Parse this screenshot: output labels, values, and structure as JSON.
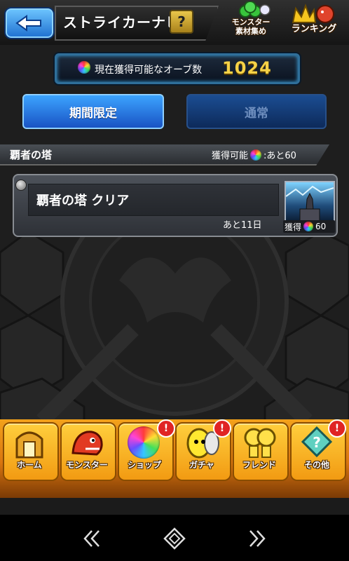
{
  "header": {
    "title": "ストライカーナビ",
    "help_label": "?",
    "collect_label_1": "モンスター",
    "collect_label_2": "素材集め",
    "ranking_label": "ランキング"
  },
  "orb_counter": {
    "label": "現在獲得可能なオーブ数",
    "value": "1024"
  },
  "tabs": [
    {
      "label": "期間限定",
      "active": true
    },
    {
      "label": "通常",
      "active": false
    }
  ],
  "section": {
    "title": "覇者の塔",
    "status_prefix": "獲得可能",
    "status_suffix": ":あと60"
  },
  "quest": {
    "name": "覇者の塔 クリア",
    "remaining": "あと11日",
    "reward_label": "獲得",
    "reward_value": "60"
  },
  "bottom_nav": [
    {
      "label": "ホーム",
      "icon": "home-icon",
      "badge": null
    },
    {
      "label": "モンスター",
      "icon": "monster-icon",
      "badge": null
    },
    {
      "label": "ショップ",
      "icon": "shop-orb-icon",
      "badge": "!"
    },
    {
      "label": "ガチャ",
      "icon": "gacha-egg-icon",
      "badge": "!"
    },
    {
      "label": "フレンド",
      "icon": "friend-icon",
      "badge": null
    },
    {
      "label": "その他",
      "icon": "other-icon",
      "badge": "!"
    }
  ],
  "android_nav": [
    "back-icon",
    "home-diamond-icon",
    "forward-icon"
  ]
}
